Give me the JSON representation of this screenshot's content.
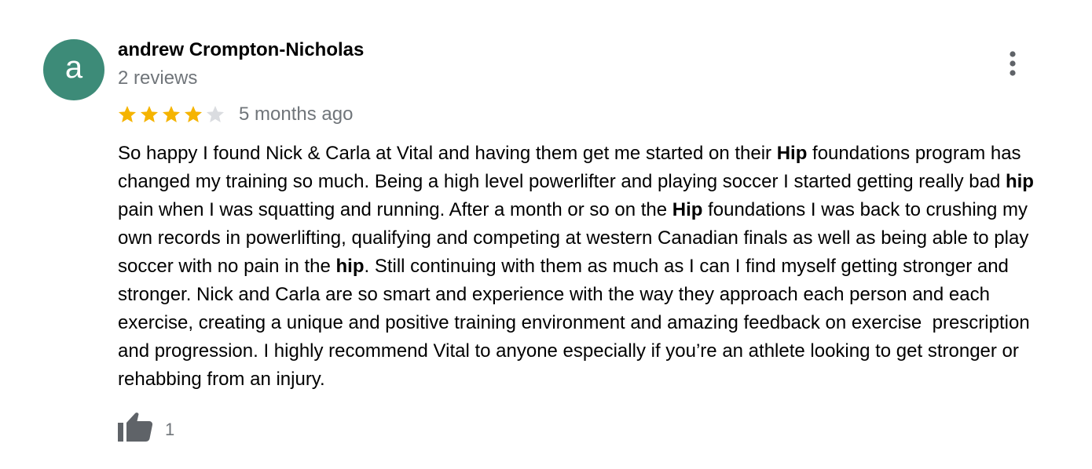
{
  "reviewer": {
    "initial": "a",
    "name": "andrew Crompton-Nicholas",
    "review_count": "2 reviews",
    "avatar_color": "#3d8b78"
  },
  "review": {
    "rating": 4,
    "max_rating": 5,
    "timestamp": "5 months ago",
    "star_filled_color": "#f5b400",
    "star_empty_color": "#dadce0",
    "text_segments": [
      {
        "text": "So happy I found Nick & Carla at Vital and having them get me started on their ",
        "bold": false
      },
      {
        "text": "Hip",
        "bold": true
      },
      {
        "text": " foundations program has changed my training so much. Being a high level powerlifter and playing soccer I started getting really bad ",
        "bold": false
      },
      {
        "text": "hip",
        "bold": true
      },
      {
        "text": " pain when I was squatting and running. After a month or so on the ",
        "bold": false
      },
      {
        "text": "Hip",
        "bold": true
      },
      {
        "text": " foundations I was back to crushing my own records in powerlifting, qualifying and competing at western Canadian finals as well as being able to play soccer with no pain in the ",
        "bold": false
      },
      {
        "text": "hip",
        "bold": true
      },
      {
        "text": ". Still continuing with them as much as I can I find myself getting stronger and stronger. Nick and Carla are so smart and experience with the way they approach each person and each exercise, creating a unique and positive training environment and amazing feedback on exercise  prescription and progression. I highly recommend Vital to anyone especially if you’re an athlete looking to get stronger or rehabbing from an injury.",
        "bold": false
      }
    ],
    "like_count": "1"
  },
  "icons": {
    "more": "more-vert-icon",
    "star": "star-icon",
    "like": "thumb-up-icon"
  }
}
